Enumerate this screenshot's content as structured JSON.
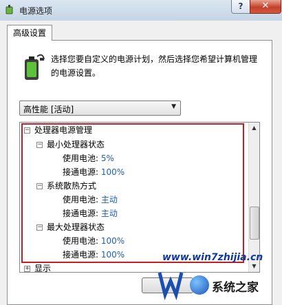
{
  "window": {
    "title": "电源选项",
    "help_label": "?",
    "close_label": "✕"
  },
  "tab": {
    "label": "高级设置"
  },
  "description": "选择您要自定义的电源计划，然后选择您希望计算机管理的电源设置。",
  "plan_select": {
    "value": "高性能 [活动]"
  },
  "tree": {
    "root": {
      "label": "处理器电源管理",
      "expander": "⊟"
    },
    "min_state": {
      "label": "最小处理器状态",
      "battery_label": "使用电池:",
      "battery_value": "5%",
      "ac_label": "接通电源:",
      "ac_value": "100%"
    },
    "cooling": {
      "label": "系统散热方式",
      "battery_label": "使用电池:",
      "battery_value": "主动",
      "ac_label": "接通电源:",
      "ac_value": "主动"
    },
    "max_state": {
      "label": "最大处理器状态",
      "battery_label": "使用电池:",
      "battery_value": "100%",
      "ac_label": "接通电源:",
      "ac_value": "100%"
    },
    "display": {
      "label": "显示"
    }
  },
  "watermark": {
    "url": "www.win7zhijia.cn",
    "site": "系统之家"
  },
  "colors": {
    "highlight": "#c21d24",
    "value_text": "#1f5fb1"
  }
}
